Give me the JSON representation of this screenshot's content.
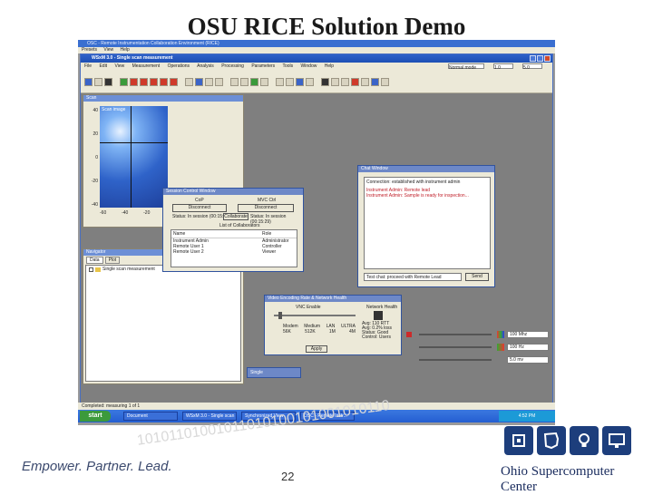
{
  "slide": {
    "title": "OSU RICE Solution Demo",
    "tagline": "Empower. Partner. Lead.",
    "page_number": "22",
    "org_name": "Ohio Supercomputer Center",
    "binary_text": "10101101001011010100101001010110"
  },
  "os_window": {
    "title": "OSC - Remote Instrumentation Collaboration Environment (RICE)",
    "menu": [
      "Presets",
      "View",
      "Help"
    ]
  },
  "app": {
    "title": "WSxM 3.0 - Single scan measurement",
    "menu": [
      "File",
      "Edit",
      "View",
      "Measurement",
      "Operations",
      "Analysis",
      "Processing",
      "Parameters",
      "Tools",
      "Window",
      "Help"
    ],
    "toolbar_fields": [
      "Normal mode",
      "1.0",
      "5.0"
    ]
  },
  "scan_panel": {
    "title": "Scan",
    "image_label": "Scan image",
    "y_ticks": [
      "40",
      "20",
      "0",
      "-20",
      "-40"
    ],
    "x_ticks": [
      "-60",
      "-40",
      "-20",
      "0"
    ]
  },
  "navigator": {
    "title": "Navigator",
    "tabs": [
      "Data",
      "Plot"
    ],
    "tree_item": "Single scan measurement"
  },
  "session_dialog": {
    "title": "Session Control Window",
    "left_group": "CoP",
    "right_group": "MVC Ctrl",
    "disconnect_label": "Disconnect",
    "left_status": "Status: In session (00:15:29)",
    "collaborate_label": "Collaborate",
    "right_status": "Status: In session (00:15:29)",
    "list_header": "List of Collaborators",
    "columns": [
      "Name",
      "Role"
    ],
    "rows": [
      {
        "name": "Instrument Admin",
        "role": "Administrator"
      },
      {
        "name": "Remote User 1",
        "role": "Controller"
      },
      {
        "name": "Remote User 2",
        "role": "Viewer"
      }
    ]
  },
  "chat": {
    "title": "Chat Window",
    "messages": [
      "Connection: established with instrument admin",
      "Instrument Admin: Remote lead",
      "Instrument Admin: Sample is ready for inspection..."
    ],
    "input_value": "Test chat: proceed with Remote Lead",
    "send_label": "Send"
  },
  "video": {
    "title": "Video Encoding Rate & Network Health",
    "vnc_label": "VNC Enable",
    "network_label": "Network Health",
    "codec_headers": [
      "Modem",
      "Medium",
      "LAN",
      "ULTRA"
    ],
    "rates": [
      "56K",
      "512K",
      "1M",
      "4M"
    ],
    "health_lines": [
      "Avg: 110 RTT",
      "Avg: 0.2% loss",
      "Status: Good",
      "Control: Users"
    ],
    "apply_label": "Apply"
  },
  "side_controls": {
    "fields": [
      "100 Mhz",
      "100 Hz",
      "5.0 mv"
    ]
  },
  "mini_window": {
    "title": "Single"
  },
  "status_bar": {
    "text": "Completed: measuring 1 of 1"
  },
  "taskbar": {
    "start_label": "start",
    "tasks": [
      "Document",
      "WSxM 3.0 - Single scan",
      "Synchronized View",
      "OSC - Remote Instr..."
    ],
    "clock": "4:52 PM"
  },
  "colors": {
    "accent": "#1d3e7c",
    "xp_blue": "#245ed1",
    "scan_blue": "#2f63c9"
  }
}
